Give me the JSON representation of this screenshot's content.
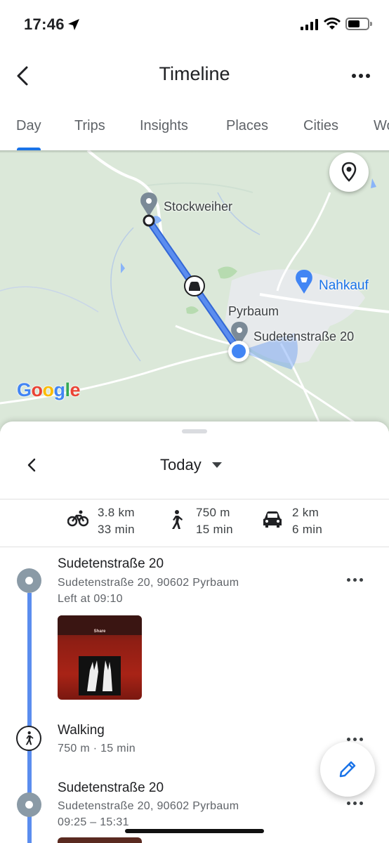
{
  "status": {
    "time": "17:46"
  },
  "header": {
    "title": "Timeline"
  },
  "tabs": [
    {
      "label": "Day",
      "active": true
    },
    {
      "label": "Trips"
    },
    {
      "label": "Insights"
    },
    {
      "label": "Places"
    },
    {
      "label": "Cities"
    },
    {
      "label": "World"
    }
  ],
  "map": {
    "labels": {
      "stockweiher": "Stockweiher",
      "nahkauf": "Nahkauf",
      "pyrbaum": "Pyrbaum",
      "sudetenstrasse": "Sudetenstraße 20"
    },
    "google_logo": [
      "G",
      "o",
      "o",
      "g",
      "l",
      "e"
    ],
    "google_colors": [
      "#4285F4",
      "#EA4335",
      "#FBBC05",
      "#4285F4",
      "#34A853",
      "#EA4335"
    ],
    "route_color": "#4f7ce6"
  },
  "sheet": {
    "date": "Today",
    "stats": {
      "bike": {
        "distance": "3.8 km",
        "duration": "33 min"
      },
      "walk": {
        "distance": "750 m",
        "duration": "15 min"
      },
      "car": {
        "distance": "2 km",
        "duration": "6 min"
      }
    },
    "timeline": [
      {
        "title": "Sudetenstraße 20",
        "address": "Sudetenstraße 20, 90602 Pyrbaum",
        "time": "Left at 09:10"
      },
      {
        "title": "Walking",
        "detail": "750 m · 15 min"
      },
      {
        "title": "Sudetenstraße 20",
        "address": "Sudetenstraße 20, 90602 Pyrbaum",
        "time": "09:25 – 15:31"
      }
    ],
    "photo_caption": "Share"
  }
}
